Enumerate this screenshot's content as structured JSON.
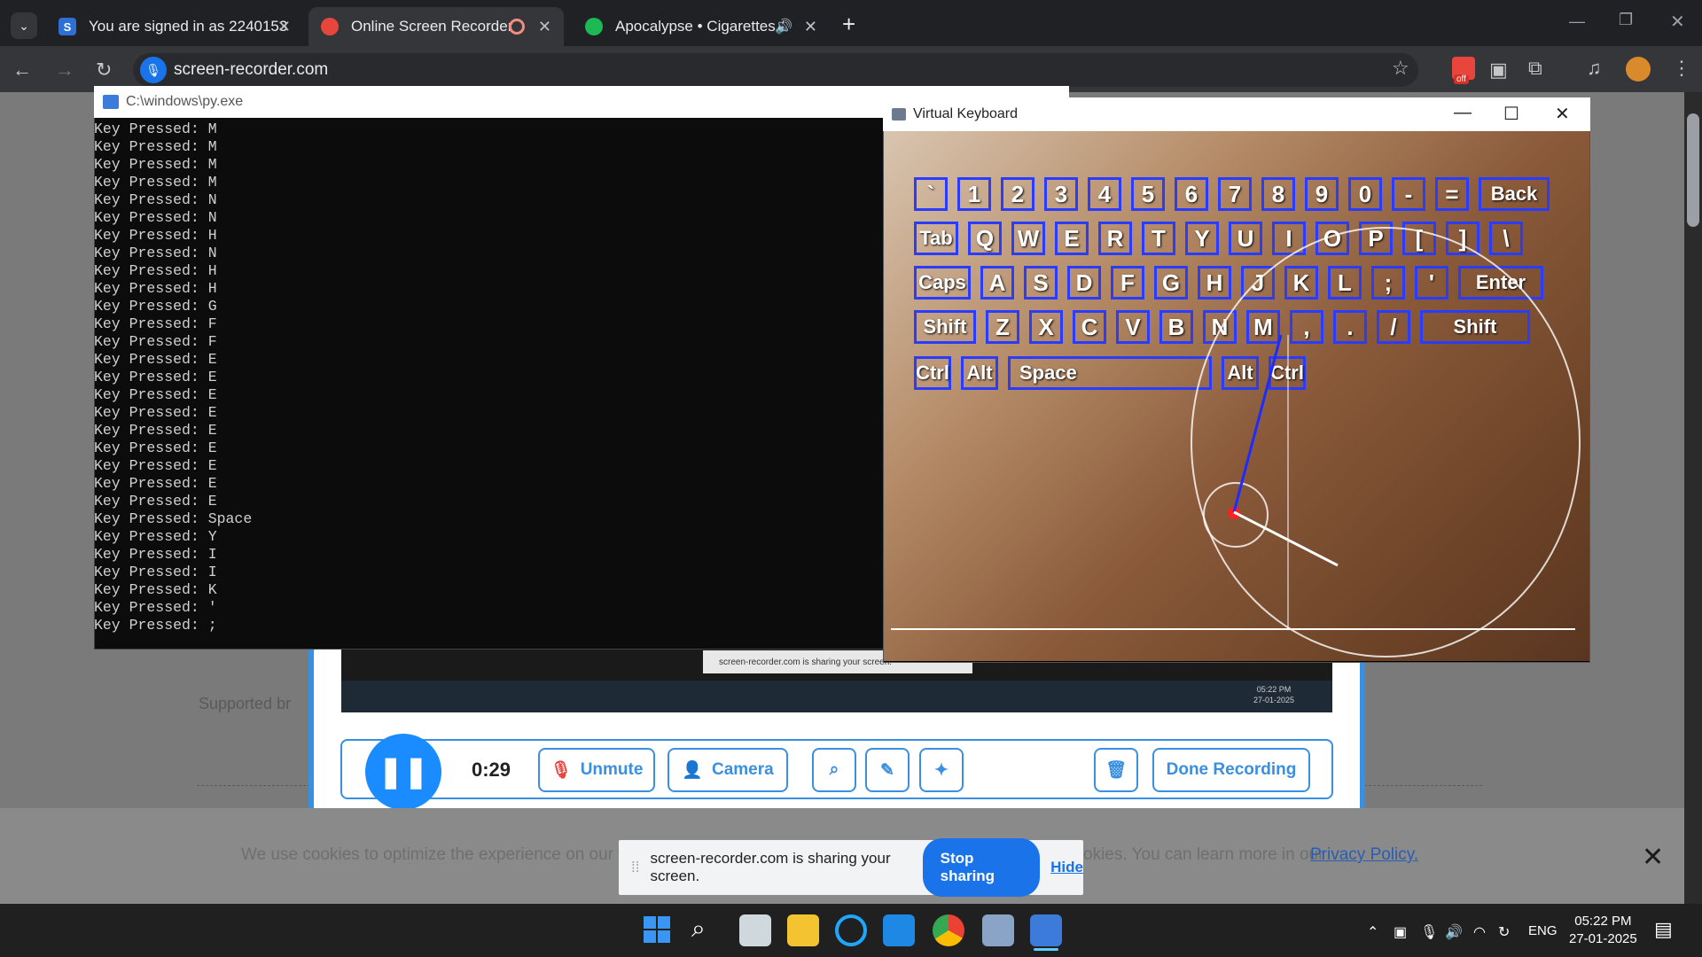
{
  "browser": {
    "tabs": [
      {
        "label": "You are signed in as 2240153",
        "active": false
      },
      {
        "label": "Online Screen Recorder",
        "active": true
      },
      {
        "label": "Apocalypse • Cigarettes Aft",
        "active": false
      }
    ],
    "url": "screen-recorder.com",
    "new_tab": "+",
    "extension_badge": "off"
  },
  "console": {
    "title": "C:\\windows\\py.exe",
    "lines": [
      "Key Pressed: M",
      "Key Pressed: M",
      "Key Pressed: M",
      "Key Pressed: M",
      "Key Pressed: N",
      "Key Pressed: N",
      "Key Pressed: H",
      "Key Pressed: N",
      "Key Pressed: H",
      "Key Pressed: H",
      "Key Pressed: G",
      "Key Pressed: F",
      "Key Pressed: F",
      "Key Pressed: E",
      "Key Pressed: E",
      "Key Pressed: E",
      "Key Pressed: E",
      "Key Pressed: E",
      "Key Pressed: E",
      "Key Pressed: E",
      "Key Pressed: E",
      "Key Pressed: E",
      "Key Pressed: Space",
      "Key Pressed: Y",
      "Key Pressed: I",
      "Key Pressed: I",
      "Key Pressed: K",
      "Key Pressed: '",
      "Key Pressed: ;"
    ]
  },
  "keyboard_window": {
    "title": "Virtual Keyboard",
    "rows": [
      [
        "`",
        "1",
        "2",
        "3",
        "4",
        "5",
        "6",
        "7",
        "8",
        "9",
        "0",
        "-",
        "=",
        "Back"
      ],
      [
        "Tab",
        "Q",
        "W",
        "E",
        "R",
        "T",
        "Y",
        "U",
        "I",
        "O",
        "P",
        "[",
        "]",
        "\\"
      ],
      [
        "Caps",
        "A",
        "S",
        "D",
        "F",
        "G",
        "H",
        "J",
        "K",
        "L",
        ";",
        "'",
        "Enter"
      ],
      [
        "Shift",
        "Z",
        "X",
        "C",
        "V",
        "B",
        "N",
        "M",
        ",",
        ".",
        "/",
        "Shift"
      ],
      [
        "Ctrl",
        "Alt",
        "Space",
        "Alt",
        "Ctrl"
      ]
    ]
  },
  "recorder": {
    "timer": "0:29",
    "unmute_label": "Unmute",
    "camera_label": "Camera",
    "done_label": "Done Recording",
    "preview_share_text": "screen-recorder.com is sharing your screen.",
    "supported_text": "Supported br"
  },
  "cookie": {
    "text_left": "We use cookies to optimize the experience on our web",
    "text_right": "okies. You can learn more in our",
    "link": "Privacy Policy."
  },
  "share_bar": {
    "message": "screen-recorder.com is sharing your screen.",
    "stop_label": "Stop sharing",
    "hide_label": "Hide"
  },
  "taskbar": {
    "language": "ENG",
    "time": "05:22 PM",
    "date": "27-01-2025"
  },
  "colors": {
    "accent": "#3b8fe0",
    "key_border": "#2a3cff",
    "stop_button": "#1a73e8"
  }
}
